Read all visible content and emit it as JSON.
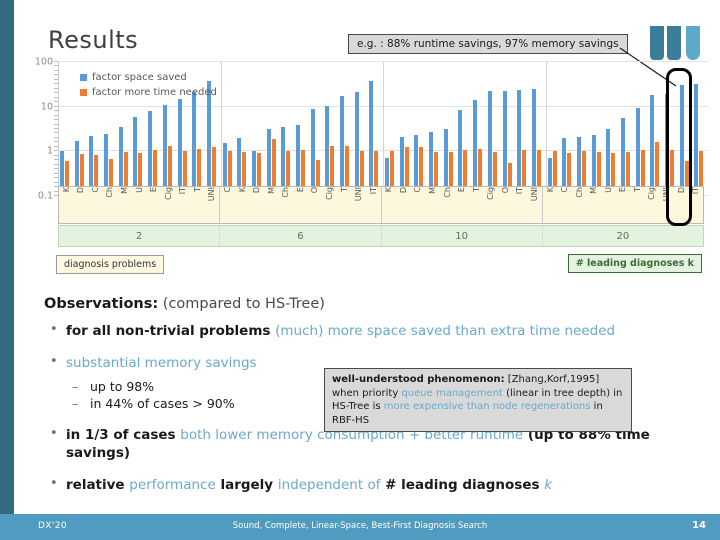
{
  "slide": {
    "title": "Results",
    "page_number": "14",
    "footer_left": "DX'20",
    "footer_center": "Sound, Complete, Linear-Space, Best-First Diagnosis Search",
    "logo_name": "mu-logo"
  },
  "callouts": {
    "example": "e.g. : 88% runtime savings, 97% memory savings",
    "left_tag": "diagnosis problems",
    "right_tag": "# leading diagnoses k",
    "phenomenon": {
      "lead": "well-understood phenomenon:",
      "cite": "[Zhang,Korf,1995]",
      "t1": "when priority ",
      "a1": "queue management",
      "t2": " (linear in tree depth) in HS-Tree is ",
      "a2": "more expensive than node regenerations",
      "t3": " in RBF-HS"
    }
  },
  "chart_data": {
    "type": "bar",
    "title": "Results",
    "xlabel": "diagnosis problems",
    "ylabel": "",
    "yscale": "log",
    "ylim": [
      0.1,
      100
    ],
    "yticks": [
      "100",
      "10",
      "1",
      "0.1"
    ],
    "grid": true,
    "legend_position": "top-left",
    "legend": [
      "factor space saved",
      "factor more time needed"
    ],
    "colors": {
      "space": "#5b9bd5",
      "time": "#ed7d31"
    },
    "group_label": "# leading diagnoses k",
    "groups": [
      {
        "k": "2",
        "categories": [
          "K",
          "D",
          "C",
          "Ch",
          "M",
          "U",
          "E",
          "Cig",
          "IT",
          "T",
          "UNI"
        ],
        "series": [
          {
            "name": "factor space saved",
            "values": [
              1.02,
              1.7,
              2.2,
              2.5,
              3.5,
              5.8,
              8.0,
              11.0,
              15.0,
              21.0,
              38.0
            ]
          },
          {
            "name": "factor more time needed",
            "values": [
              0.62,
              0.86,
              0.84,
              0.66,
              0.97,
              0.9,
              1.05,
              1.3,
              1.0,
              1.15,
              1.28
            ]
          }
        ]
      },
      {
        "k": "6",
        "categories": [
          "C",
          "K",
          "D",
          "M",
          "Ch",
          "E",
          "O",
          "Cig",
          "T",
          "UNI",
          "IT"
        ],
        "series": [
          {
            "name": "factor space saved",
            "values": [
              1.55,
              1.95,
              1.02,
              3.2,
              3.5,
              3.9,
              9.0,
              10.5,
              17.0,
              21.0,
              38.0
            ]
          },
          {
            "name": "factor more time needed",
            "values": [
              1.0,
              0.95,
              0.92,
              1.9,
              1.0,
              1.08,
              0.63,
              1.32,
              1.35,
              1.0,
              1.0
            ]
          }
        ]
      },
      {
        "k": "10",
        "categories": [
          "K",
          "D",
          "C",
          "M",
          "Ch",
          "E",
          "T",
          "Cig",
          "O",
          "IT",
          "UNI"
        ],
        "series": [
          {
            "name": "factor space saved",
            "values": [
              0.72,
              2.1,
              2.3,
              2.7,
              3.2,
              8.5,
              14.0,
              22.0,
              23.0,
              24.0,
              25.0
            ]
          },
          {
            "name": "factor more time needed",
            "values": [
              1.0,
              1.25,
              1.22,
              0.97,
              0.98,
              1.1,
              1.15,
              0.96,
              0.55,
              1.1,
              1.05
            ]
          }
        ]
      },
      {
        "k": "20",
        "categories": [
          "K",
          "C",
          "Ch",
          "M",
          "U",
          "E",
          "T",
          "Cig",
          "UNI",
          "D",
          "IT"
        ],
        "series": [
          {
            "name": "factor space saved",
            "values": [
              0.7,
              2.0,
              2.15,
              2.3,
              3.1,
              5.5,
              9.5,
              18.0,
              19.0,
              30.0,
              32.0
            ]
          },
          {
            "name": "factor more time needed",
            "values": [
              1.0,
              0.93,
              1.0,
              0.98,
              0.93,
              0.95,
              1.05,
              1.6,
              1.08,
              0.6,
              1.0
            ]
          }
        ]
      }
    ]
  },
  "observations": {
    "heading": "Observations:",
    "heading_note": "(compared to HS-Tree)",
    "bullets": [
      {
        "parts": [
          {
            "t": "for all non-trivial problems ",
            "style": "bold"
          },
          {
            "t": "(much) more space saved than extra time needed",
            "style": "accent"
          }
        ],
        "sub": []
      },
      {
        "parts": [
          {
            "t": "substantial memory savings",
            "style": "accent"
          }
        ],
        "sub": [
          "up to 98%",
          "in 44% of cases > 90%"
        ]
      },
      {
        "parts": [
          {
            "t": "in 1/3 of cases ",
            "style": "bold"
          },
          {
            "t": "both lower memory consumption + better runtime",
            "style": "accent"
          },
          {
            "t": " (up to 88% time savings)",
            "style": "bold"
          }
        ],
        "sub": []
      },
      {
        "parts": [
          {
            "t": "relative ",
            "style": "bold"
          },
          {
            "t": "performance",
            "style": "accent"
          },
          {
            "t": " largely ",
            "style": "bold"
          },
          {
            "t": "independent of",
            "style": "accent"
          },
          {
            "t": " # leading diagnoses ",
            "style": "bold"
          },
          {
            "t": "k",
            "style": "accent-italic"
          }
        ],
        "sub": []
      }
    ]
  }
}
